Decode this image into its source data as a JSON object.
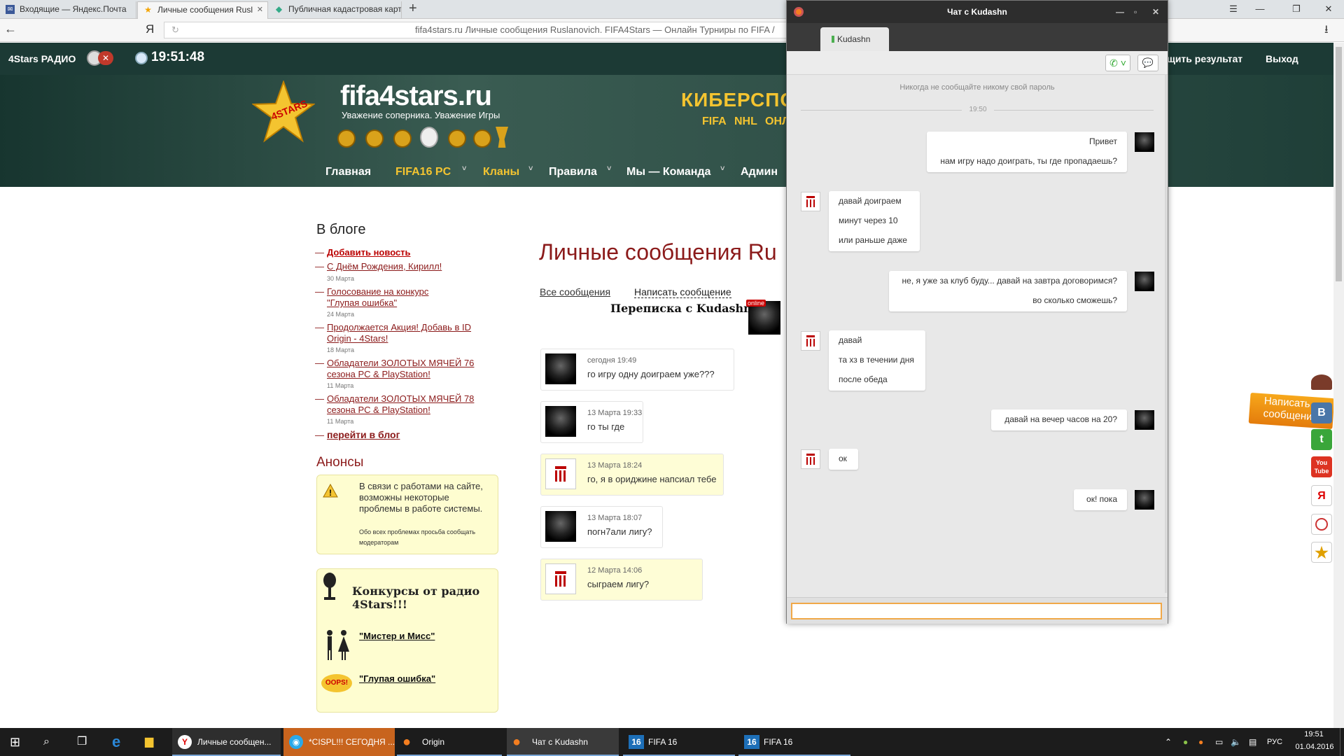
{
  "browser": {
    "tabs": [
      {
        "title": "Входящие — Яндекс.Почта"
      },
      {
        "title": "Личные сообщения Rusl"
      },
      {
        "title": "Публичная кадастровая карт"
      }
    ],
    "new_tab": "+",
    "yandex_logo": "Я",
    "url_text": "fifa4stars.ru  Личные сообщения Ruslanovich. FIFA4Stars — Онлайн Турниры по FIFA /"
  },
  "site": {
    "radio_label": "4Stars РАДИО",
    "clock": "19:51:48",
    "logo_text": "fifa4stars.ru",
    "logo_badge": "4STARS",
    "slogan": "Уважение соперника.  Уважение Игры",
    "header_title": "КИБЕРСПО",
    "header_sub": [
      "FIFA",
      "NHL",
      "ОНЛ"
    ],
    "right_links": [
      "щить результат",
      "Выход"
    ],
    "nav": [
      {
        "label": "Главная",
        "arrow": ""
      },
      {
        "label": "FIFA16 PC",
        "arrow": "˅"
      },
      {
        "label": "Кланы",
        "arrow": "˅"
      },
      {
        "label": "Правила",
        "arrow": "˅"
      },
      {
        "label": "Мы — Команда",
        "arrow": "˅"
      },
      {
        "label": "Админ",
        "arrow": ""
      }
    ]
  },
  "sidebar": {
    "blog_title": "В блоге",
    "dash": "—",
    "items": [
      {
        "label": "Добавить новость",
        "date": ""
      },
      {
        "label": "С Днём Рождения, Кирилл!",
        "date": "30 Марта"
      },
      {
        "label": "Голосование на конкурс \"Глупая ошибка\"",
        "date": "24 Марта"
      },
      {
        "label": "Продолжается Акция! Добавь в ID Origin - 4Stars!",
        "date": "18 Марта"
      },
      {
        "label": "Обладатели ЗОЛОТЫХ МЯЧЕЙ 76 сезона PC & PlayStation!",
        "date": "11 Марта"
      },
      {
        "label": "Обладатели ЗОЛОТЫХ МЯЧЕЙ 78 сезона PC & PlayStation!",
        "date": "11 Марта"
      }
    ],
    "blog_link": "перейти в блог",
    "announce_title": "Анонсы",
    "announce_text": "В связи с работами на сайте, возможны некоторые проблемы в работе системы.",
    "announce_small": "Обо всех проблемах просьба сообщать модераторам",
    "contest_title": "Конкурсы от радио 4Stars!!!",
    "contest_links": [
      "\"Мистер и Мисс\"",
      "\"Глупая ошибка\""
    ],
    "oops_text": "OOPS!"
  },
  "main": {
    "title": "Личные сообщения Ru",
    "all_messages": "Все сообщения",
    "write_message": "Написать сообщение",
    "conversation": "Переписка с Kudashn",
    "online_badge": "online",
    "messages": [
      {
        "time": "сегодня 19:49",
        "text": "го игру одну доиграем уже???",
        "who": "dark"
      },
      {
        "time": "13 Марта 19:33",
        "text": "го ты где",
        "who": "dark"
      },
      {
        "time": "13 Марта 18:24",
        "text": "го, я в ориджине напсиал тебе",
        "who": "flag"
      },
      {
        "time": "13 Марта 18:07",
        "text": "погн7али лигу?",
        "who": "dark"
      },
      {
        "time": "12 Марта 14:06",
        "text": "сыграем лигу?",
        "who": "flag"
      }
    ]
  },
  "chat": {
    "title": "Чат с Kudashn",
    "tab_name": "Kudashn",
    "warning": "Никогда не сообщайте никому свой пароль",
    "time_divider": "19:50",
    "bubbles": [
      {
        "side": "right",
        "lines": [
          "Привет",
          "нам игру надо доиграть, ты где пропадаешь?"
        ]
      },
      {
        "side": "left",
        "lines": [
          "давай доиграем",
          "минут через 10",
          "или раньше даже"
        ]
      },
      {
        "side": "right",
        "lines": [
          "не, я уже за клуб буду... давай на завтра договоримся?",
          "во сколько сможешь?"
        ]
      },
      {
        "side": "left",
        "lines": [
          "давай",
          "та хз в течении дня",
          "после обеда"
        ]
      },
      {
        "side": "right",
        "lines": [
          "давай на вечер часов на 20?"
        ]
      },
      {
        "side": "left",
        "lines": [
          "ок"
        ]
      },
      {
        "side": "right",
        "lines": [
          "ок! пока"
        ]
      }
    ],
    "input_value": ""
  },
  "floating": {
    "write_label": "Написать сообщени",
    "social": [
      "В",
      "t",
      "You Tube",
      "Я",
      "",
      "★"
    ]
  },
  "taskbar": {
    "items": [
      {
        "label": "Личные сообщен...",
        "icon": "Y"
      },
      {
        "label": "*CISPL!!! СЕГОДНЯ ...",
        "icon": "◉"
      },
      {
        "label": "Origin",
        "icon": "●"
      },
      {
        "label": "Чат с Kudashn",
        "icon": "●"
      },
      {
        "label": "FIFA 16",
        "icon": "16"
      },
      {
        "label": "FIFA 16",
        "icon": "16"
      }
    ],
    "lang": "РУС",
    "time": "19:51",
    "date": "01.04.2016"
  },
  "colors": {
    "site_dark": "#1c3a35",
    "accent_gold": "#f4c430",
    "link_red": "#8b1a1a",
    "chat_accent": "#f47e20"
  }
}
